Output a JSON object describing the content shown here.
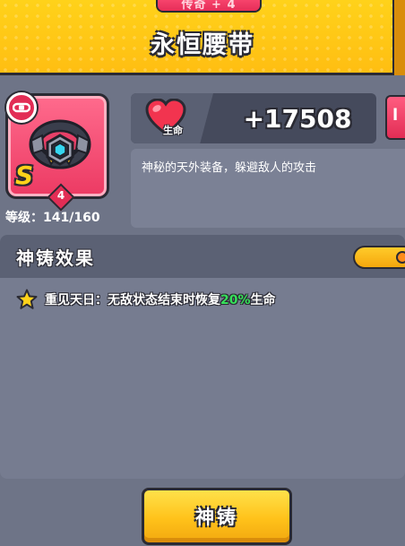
{
  "header": {
    "rarity_tab": "传奇 + 4",
    "title": "永恒腰带"
  },
  "item": {
    "type_icon": "belt-type-icon",
    "image_icon": "belt-icon",
    "grade": "S",
    "stars": "4",
    "level_text": "等级：141/160",
    "card_color": "#ec3a63"
  },
  "stat": {
    "icon": "heart-icon",
    "label": "生命",
    "value": "+17508"
  },
  "description": "神秘的天外装备，躲避敌人的攻击",
  "forge": {
    "section_title": "神铸效果",
    "effect": {
      "icon": "star-icon",
      "text_before": "重见天日：无敌状态结束时恢复",
      "highlight": "20%",
      "text_after": "生命",
      "highlight_color": "#36e05a"
    }
  },
  "button": {
    "label": "神铸",
    "color": "#ffc21a"
  }
}
